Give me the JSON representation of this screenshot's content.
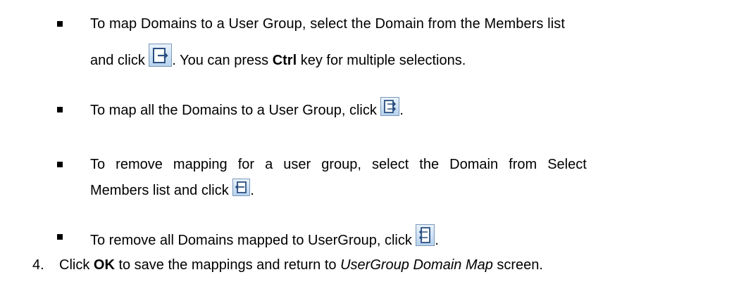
{
  "bullets": [
    {
      "text_a": "To map Domains to a User Group, select the Domain from the Members list",
      "text_b": "and click ",
      "icon": "add-selected-icon",
      "text_c": ". You can press ",
      "bold": "Ctrl",
      "text_d": " key for multiple selections."
    },
    {
      "text_a": "To map all the Domains to a User Group, click ",
      "icon": "add-all-icon",
      "text_b": "."
    },
    {
      "text_a": "To remove mapping for a user group, select the Domain from Select",
      "text_b": "Members list and click ",
      "icon": "remove-selected-icon",
      "text_c": "."
    },
    {
      "text_a": "To remove all Domains mapped to UserGroup, click ",
      "icon": "remove-all-icon",
      "text_b": "."
    }
  ],
  "step4": {
    "number": "4.",
    "text_a": "Click ",
    "bold": "OK",
    "text_b": " to save the mappings and return to ",
    "italic": "UserGroup Domain Map",
    "text_c": " screen."
  }
}
